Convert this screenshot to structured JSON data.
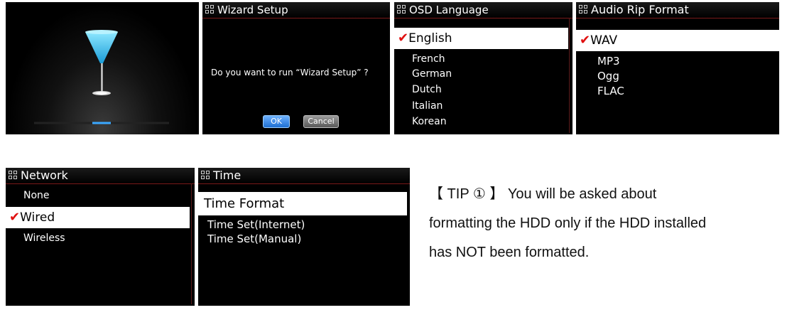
{
  "boot_screen": {},
  "wizard": {
    "title": "Wizard Setup",
    "question": "Do you want to run “Wizard Setup” ?",
    "ok_label": "OK",
    "cancel_label": "Cancel"
  },
  "osd_language": {
    "title": "OSD Language",
    "check": "✔",
    "items": [
      "English",
      "French",
      "German",
      "Dutch",
      "Italian",
      "Korean"
    ],
    "selected": "English"
  },
  "audio_rip_format": {
    "title": "Audio Rip Format",
    "check": "✔",
    "items": [
      "WAV",
      "MP3",
      "Ogg",
      "FLAC"
    ],
    "selected": "WAV"
  },
  "network": {
    "title": "Network",
    "check": "✔",
    "items": [
      "None",
      "Wired",
      "Wireless"
    ],
    "selected": "Wired"
  },
  "time": {
    "title": "Time",
    "items": [
      "Time Format",
      "Time Set(Internet)",
      "Time Set(Manual)"
    ],
    "selected": "Time Format"
  },
  "tip": {
    "line1": "【 TIP ① 】 You will be asked about",
    "line2": "formatting the HDD only if the HDD installed",
    "line3": "has NOT been formatted."
  },
  "colors": {
    "panel_bg": "#000000",
    "check_red": "#e01010",
    "ok_blue": "#1f6fd1"
  }
}
